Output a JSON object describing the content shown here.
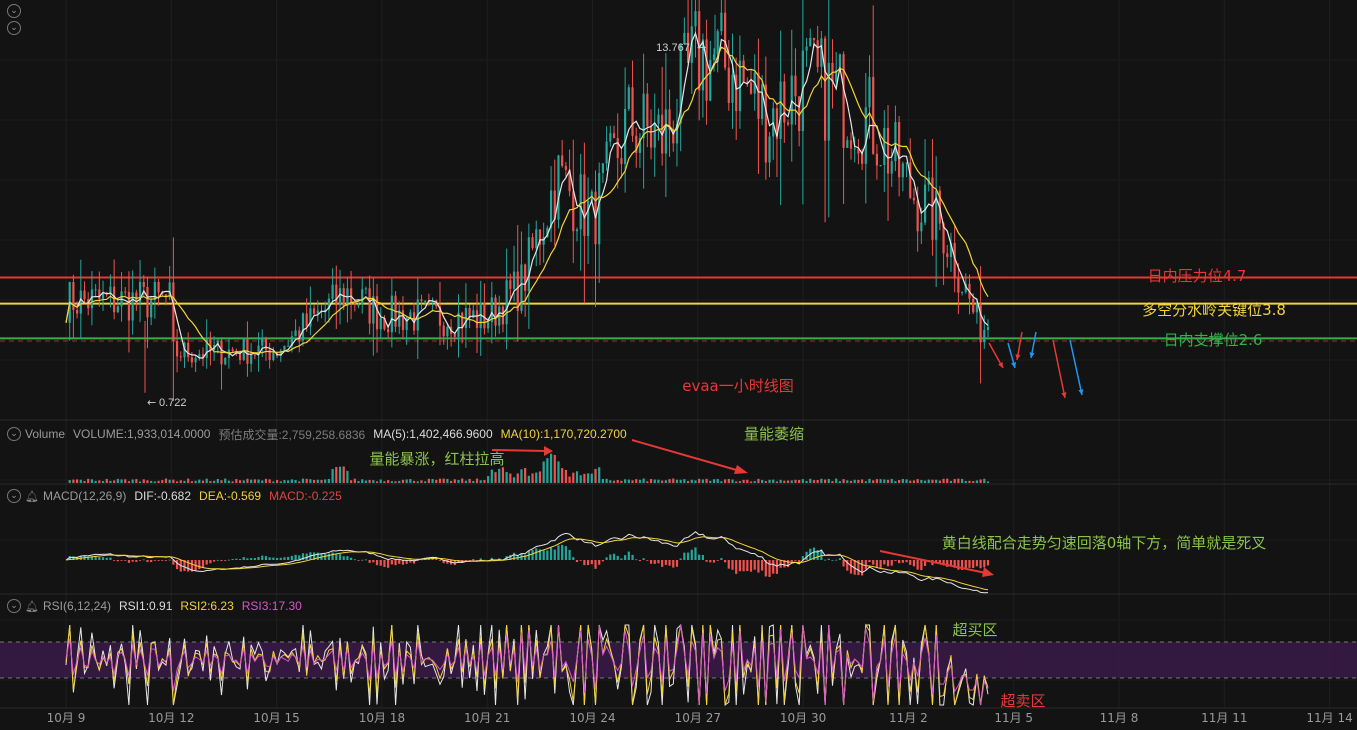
{
  "chart_data": [
    {
      "type": "candlestick",
      "timeframe": "1h",
      "title": "evaa一小时线图",
      "x_ticks": [
        "10月 9",
        "10月 12",
        "10月 15",
        "10月 18",
        "10月 21",
        "10月 24",
        "10月 27",
        "10月 30",
        "11月 2",
        "11月 5",
        "11月 8",
        "11月 11",
        "11月 14"
      ],
      "ylim": [
        0,
        15.0
      ],
      "grid": true,
      "price_close_samples": {
        "x": [
          "10月 9",
          "10月 12",
          "10月 12",
          "10月 15",
          "10月 17",
          "10月 18",
          "10月 21",
          "10月 22",
          "10月 23",
          "10月 24",
          "10月 25",
          "10月 26",
          "10月 27",
          "10月 28",
          "10月 29",
          "10月 30",
          "10月 31",
          "11月 1",
          "11月 2",
          "11月 3",
          "11月 4"
        ],
        "y": [
          3.9,
          3.9,
          2.1,
          2.2,
          4.2,
          3.4,
          3.3,
          4.5,
          8.2,
          6.7,
          10.0,
          9.5,
          12.4,
          11.9,
          10.2,
          11.5,
          11.0,
          10.0,
          7.8,
          6.4,
          3.0
        ]
      },
      "high_label": "13.767",
      "low_label": "0.722",
      "levels": [
        {
          "value": 4.7,
          "label": "日内压力位4.7",
          "color": "#e53935"
        },
        {
          "value": 3.8,
          "label": "多空分水岭关键位3.8",
          "color": "#f2d33a"
        },
        {
          "value": 2.6,
          "label": "日内支撑位2.6",
          "color": "#33b04a"
        }
      ],
      "projection_arrows": [
        {
          "color": "#e53935"
        },
        {
          "color": "#2196f3"
        },
        {
          "color": "#e53935"
        },
        {
          "color": "#2196f3"
        },
        {
          "color": "#e53935"
        },
        {
          "color": "#2196f3"
        }
      ],
      "ma_colors": {
        "fast": "#e6e6e6",
        "slow": "#f2d33a"
      }
    },
    {
      "type": "bar",
      "panel": "volume",
      "legend": {
        "name": "Volume",
        "volume": "VOLUME:1,933,014.0000",
        "est": "预估成交量:2,759,258.6836",
        "ma5": "MA(5):1,402,466.9600",
        "ma10": "MA(10):1,170,720.2700"
      },
      "annotations": [
        "量能暴涨，红柱拉高",
        "量能萎缩"
      ]
    },
    {
      "type": "bar",
      "panel": "macd",
      "legend": {
        "name": "MACD(12,26,9)",
        "dif": "DIF:-0.682",
        "dea": "DEA:-0.569",
        "macd": "MACD:-0.225"
      },
      "annotation": "黄白线配合走势匀速回落0轴下方，简单就是死叉"
    },
    {
      "type": "line",
      "panel": "rsi",
      "legend": {
        "name": "RSI(6,12,24)",
        "rsi1": "RSI1:0.91",
        "rsi2": "RSI2:6.23",
        "rsi3": "RSI3:17.30"
      },
      "overbought_label": "超买区",
      "oversold_label": "超卖区"
    }
  ],
  "ui": {
    "top_buttons": [
      "⌄",
      "⌄"
    ],
    "colors": {
      "up": "#26a69a",
      "down": "#ef5350",
      "background": "#131313",
      "band": "#3a1a48"
    }
  }
}
